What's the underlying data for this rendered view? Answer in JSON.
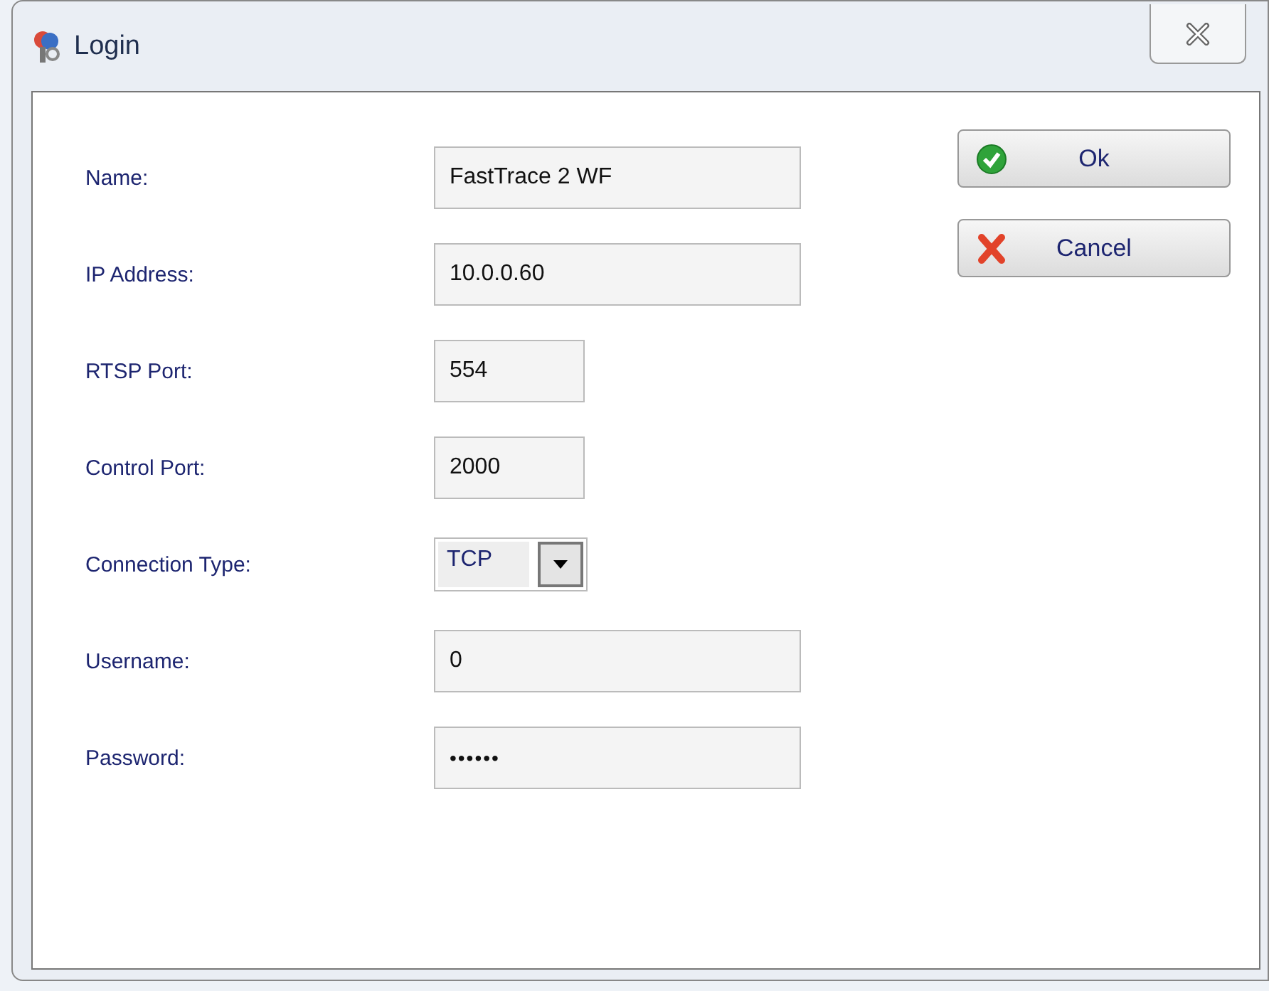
{
  "window": {
    "title": "Login"
  },
  "fields": [
    {
      "label": "Name:",
      "kind": "text",
      "value": "FastTrace 2 WF"
    },
    {
      "label": "IP Address:",
      "kind": "text",
      "value": "10.0.0.60"
    },
    {
      "label": "RTSP Port:",
      "kind": "port",
      "value": "554"
    },
    {
      "label": "Control Port:",
      "kind": "port",
      "value": "2000"
    },
    {
      "label": "Connection Type:",
      "kind": "combo",
      "value": "TCP"
    },
    {
      "label": "Username:",
      "kind": "text",
      "value": "0"
    },
    {
      "label": "Password:",
      "kind": "password",
      "value": "••••••"
    }
  ],
  "buttons": [
    {
      "label": "Ok",
      "kind": "ok"
    },
    {
      "label": "Cancel",
      "kind": "cancel"
    }
  ]
}
